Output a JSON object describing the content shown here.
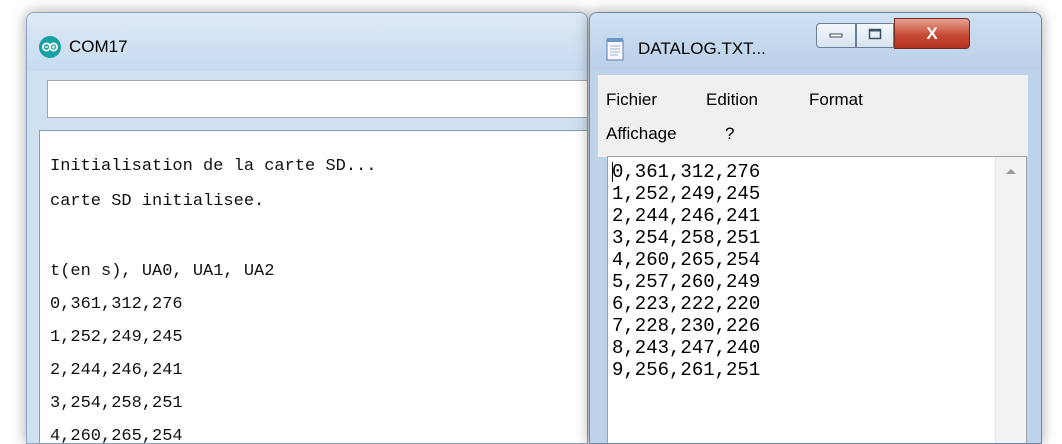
{
  "serial_monitor": {
    "title": "COM17",
    "input_value": "",
    "output_lines": [
      "Initialisation de la carte SD...",
      "carte SD initialisee.",
      "",
      "t(en s), UA0, UA1, UA2",
      "0,361,312,276",
      "1,252,249,245",
      "2,244,246,241",
      "3,254,258,251",
      "4,260,265,254"
    ]
  },
  "notepad": {
    "title": "DATALOG.TXT...",
    "close_label": "X",
    "menu": {
      "file": "Fichier",
      "edit": "Edition",
      "format": "Format",
      "view": "Affichage",
      "help": "?"
    },
    "lines": [
      "0,361,312,276",
      "1,252,249,245",
      "2,244,246,241",
      "3,254,258,251",
      "4,260,265,254",
      "5,257,260,249",
      "6,223,222,220",
      "7,228,230,226",
      "8,243,247,240",
      "9,256,261,251"
    ]
  },
  "colors": {
    "arduino_logo": "#17a1a5",
    "close_button": "#c74b35",
    "window_frame": "#bcd3ea"
  },
  "icons": {
    "serial_monitor_logo": "arduino-logo-icon",
    "notepad_file": "notepad-icon",
    "minimize": "minimize-icon",
    "maximize": "maximize-icon",
    "close": "close-icon"
  }
}
